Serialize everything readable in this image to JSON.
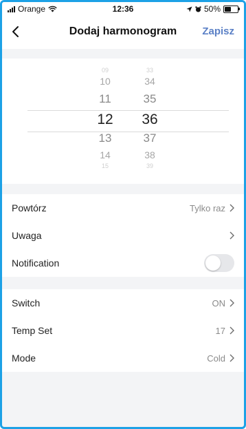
{
  "status": {
    "carrier": "Orange",
    "time": "12:36",
    "battery": "50%",
    "battery_level": 0.5
  },
  "header": {
    "back_icon": "chevron-left-icon",
    "title": "Dodaj harmonogram",
    "save_label": "Zapisz",
    "accent": "#5b80c6"
  },
  "picker": {
    "hours": [
      "09",
      "10",
      "11",
      "12",
      "13",
      "14",
      "15"
    ],
    "minutes": [
      "33",
      "34",
      "35",
      "36",
      "37",
      "38",
      "39"
    ],
    "selected_hour": "12",
    "selected_minute": "36"
  },
  "settings": {
    "repeat": {
      "label": "Powtórz",
      "value": "Tylko raz"
    },
    "note": {
      "label": "Uwaga",
      "value": ""
    },
    "notification": {
      "label": "Notification",
      "enabled": false
    }
  },
  "device": {
    "switch": {
      "label": "Switch",
      "value": "ON"
    },
    "temp": {
      "label": "Temp Set",
      "value": "17"
    },
    "mode": {
      "label": "Mode",
      "value": "Cold"
    }
  }
}
